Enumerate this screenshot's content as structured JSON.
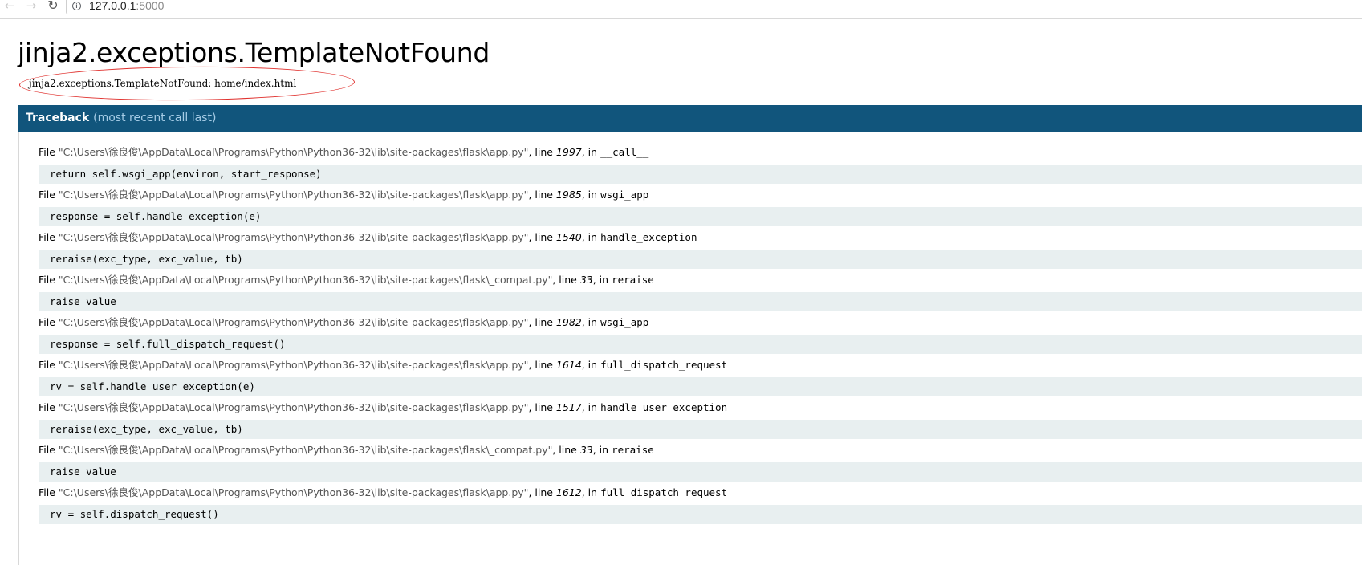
{
  "browser": {
    "url_host": "127.0.0.1",
    "url_port": ":5000"
  },
  "page": {
    "title": "jinja2.exceptions.TemplateNotFound",
    "error_message": "jinja2.exceptions.TemplateNotFound: home/index.html",
    "traceback_label": "Traceback",
    "traceback_sub": "(most recent call last)"
  },
  "frames": [
    {
      "file": "\"C:\\Users\\徐良俊\\AppData\\Local\\Programs\\Python\\Python36-32\\lib\\site-packages\\flask\\app.py\"",
      "line": "1997",
      "func": "__call__",
      "code": "return self.wsgi_app(environ, start_response)"
    },
    {
      "file": "\"C:\\Users\\徐良俊\\AppData\\Local\\Programs\\Python\\Python36-32\\lib\\site-packages\\flask\\app.py\"",
      "line": "1985",
      "func": "wsgi_app",
      "code": "response = self.handle_exception(e)"
    },
    {
      "file": "\"C:\\Users\\徐良俊\\AppData\\Local\\Programs\\Python\\Python36-32\\lib\\site-packages\\flask\\app.py\"",
      "line": "1540",
      "func": "handle_exception",
      "code": "reraise(exc_type, exc_value, tb)"
    },
    {
      "file": "\"C:\\Users\\徐良俊\\AppData\\Local\\Programs\\Python\\Python36-32\\lib\\site-packages\\flask\\_compat.py\"",
      "line": "33",
      "func": "reraise",
      "code": "raise value"
    },
    {
      "file": "\"C:\\Users\\徐良俊\\AppData\\Local\\Programs\\Python\\Python36-32\\lib\\site-packages\\flask\\app.py\"",
      "line": "1982",
      "func": "wsgi_app",
      "code": "response = self.full_dispatch_request()"
    },
    {
      "file": "\"C:\\Users\\徐良俊\\AppData\\Local\\Programs\\Python\\Python36-32\\lib\\site-packages\\flask\\app.py\"",
      "line": "1614",
      "func": "full_dispatch_request",
      "code": "rv = self.handle_user_exception(e)"
    },
    {
      "file": "\"C:\\Users\\徐良俊\\AppData\\Local\\Programs\\Python\\Python36-32\\lib\\site-packages\\flask\\app.py\"",
      "line": "1517",
      "func": "handle_user_exception",
      "code": "reraise(exc_type, exc_value, tb)"
    },
    {
      "file": "\"C:\\Users\\徐良俊\\AppData\\Local\\Programs\\Python\\Python36-32\\lib\\site-packages\\flask\\_compat.py\"",
      "line": "33",
      "func": "reraise",
      "code": "raise value"
    },
    {
      "file": "\"C:\\Users\\徐良俊\\AppData\\Local\\Programs\\Python\\Python36-32\\lib\\site-packages\\flask\\app.py\"",
      "line": "1612",
      "func": "full_dispatch_request",
      "code": "rv = self.dispatch_request()"
    }
  ],
  "labels": {
    "file_prefix": "File ",
    "line_sep": ", line ",
    "in_sep": ", in "
  },
  "colors": {
    "traceback_header_bg": "#11557c",
    "code_bg": "#e8eff0",
    "annotation_red": "#e0312e"
  }
}
